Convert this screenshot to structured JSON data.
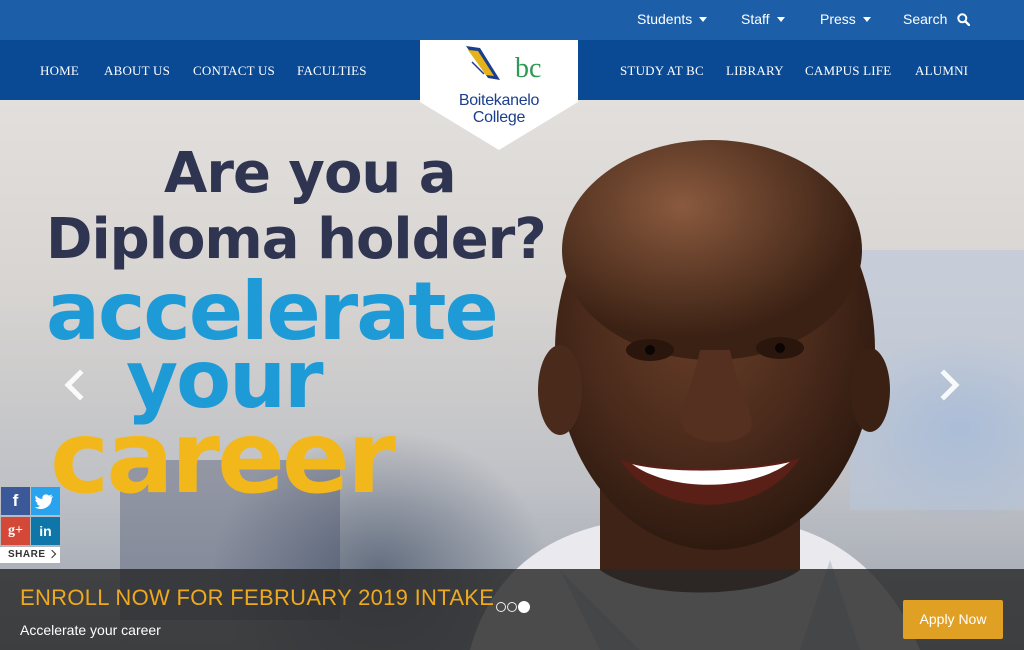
{
  "topbar": {
    "items": [
      {
        "label": "Students",
        "has_dropdown": true
      },
      {
        "label": "Staff",
        "has_dropdown": true
      },
      {
        "label": "Press",
        "has_dropdown": true
      }
    ],
    "search_label": "Search",
    "search_icon": "magnifier-icon"
  },
  "mainnav": {
    "left": [
      "HOME",
      "ABOUT US",
      "CONTACT US",
      "FACULTIES"
    ],
    "right": [
      "STUDY AT BC",
      "LIBRARY",
      "CAMPUS LIFE",
      "ALUMNI"
    ]
  },
  "logo": {
    "line1": "Boitekanelo",
    "line2": "College",
    "mark_text": "bc"
  },
  "hero": {
    "headline": [
      "Are you a",
      "Diploma holder?",
      "accelerate",
      "your",
      "career"
    ],
    "prev_icon": "chevron-left-icon",
    "next_icon": "chevron-right-icon"
  },
  "share": {
    "label": "SHARE",
    "networks": [
      {
        "name": "facebook",
        "glyph": "f"
      },
      {
        "name": "twitter",
        "glyph": ""
      },
      {
        "name": "google-plus",
        "glyph": "g+"
      },
      {
        "name": "linkedin",
        "glyph": "in"
      }
    ]
  },
  "caption": {
    "title": "ENROLL NOW FOR FEBRUARY 2019 INTAKE",
    "subtitle": "Accelerate your career",
    "slides_total": 3,
    "active_slide": 3,
    "cta": "Apply Now"
  },
  "colors": {
    "topbar": "#1c5ea8",
    "nav": "#0a4a95",
    "headline_dark": "#2f3450",
    "headline_blue": "#1e9bd7",
    "headline_yellow": "#f2b81b",
    "caption_title": "#f0a91d",
    "cta": "#e0a024"
  }
}
